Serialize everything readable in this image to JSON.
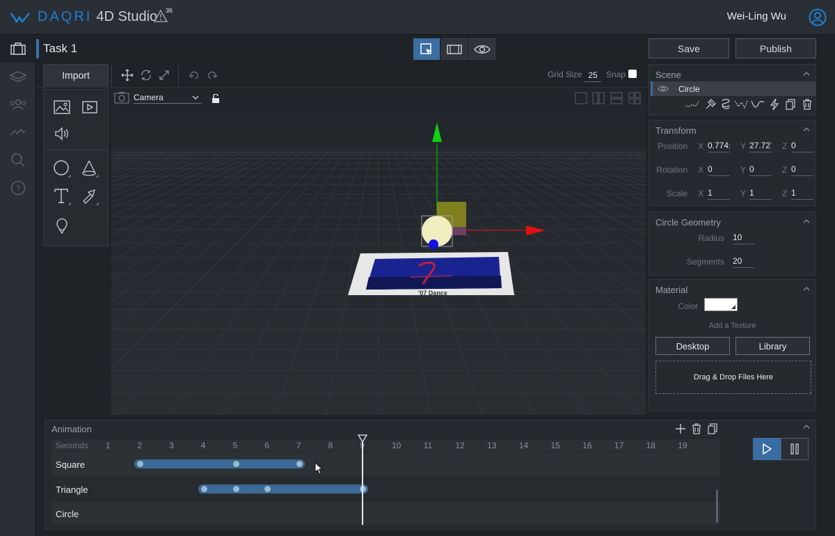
{
  "topbar": {
    "brand_daqri": "DAQRI",
    "brand_product": "4D Studio",
    "warning_count": "36",
    "user_name": "Wei-Ling Wu"
  },
  "task": {
    "title": "Task 1",
    "save_label": "Save",
    "publish_label": "Publish"
  },
  "toolbar": {
    "import_label": "Import",
    "grid_size_label": "Grid Size",
    "grid_size_value": "25",
    "snap_label": "Snap"
  },
  "camera": {
    "selected": "Camera"
  },
  "scene": {
    "title": "Scene",
    "items": [
      {
        "label": "Circle"
      }
    ]
  },
  "transform": {
    "title": "Transform",
    "position_label": "Position",
    "rotation_label": "Rotation",
    "scale_label": "Scale",
    "axis_x": "X",
    "axis_y": "Y",
    "axis_z": "Z",
    "position": {
      "x": "0.774:",
      "y": "27.72´",
      "z": "0"
    },
    "rotation": {
      "x": "0",
      "y": "0",
      "z": "0"
    },
    "scale": {
      "x": "1",
      "y": "1",
      "z": "1"
    }
  },
  "geometry": {
    "title": "Circle Geometry",
    "radius_label": "Radius",
    "radius_value": "10",
    "segments_label": "Segments",
    "segments_value": "20"
  },
  "material": {
    "title": "Material",
    "color_label": "Color",
    "color_value": "#ffffff",
    "add_texture_label": "Add a Texture",
    "desktop_label": "Desktop",
    "library_label": "Library",
    "drop_label": "Drag & Drop Files Here"
  },
  "viewport": {
    "poster_caption": "'07 Dance"
  },
  "animation": {
    "title": "Animation",
    "ruler_label": "Seconds",
    "ticks": [
      "1",
      "2",
      "3",
      "4",
      "5",
      "6",
      "7",
      "8",
      "9",
      "10",
      "11",
      "12",
      "13",
      "14",
      "15",
      "16",
      "17",
      "18",
      "19"
    ],
    "playhead_second": 9,
    "tracks": [
      {
        "label": "Square",
        "start": 2,
        "end": 7,
        "keyframes": [
          2,
          5,
          7
        ]
      },
      {
        "label": "Triangle",
        "start": 4,
        "end": 9,
        "keyframes": [
          4,
          5,
          6,
          9
        ]
      },
      {
        "label": "Circle",
        "start": null,
        "end": null,
        "keyframes": []
      }
    ]
  },
  "colors": {
    "accent": "#3a6da1",
    "brand": "#1d7fd1",
    "axis_x": "#e01010",
    "axis_y": "#10d010",
    "axis_z": "#1010e0"
  }
}
